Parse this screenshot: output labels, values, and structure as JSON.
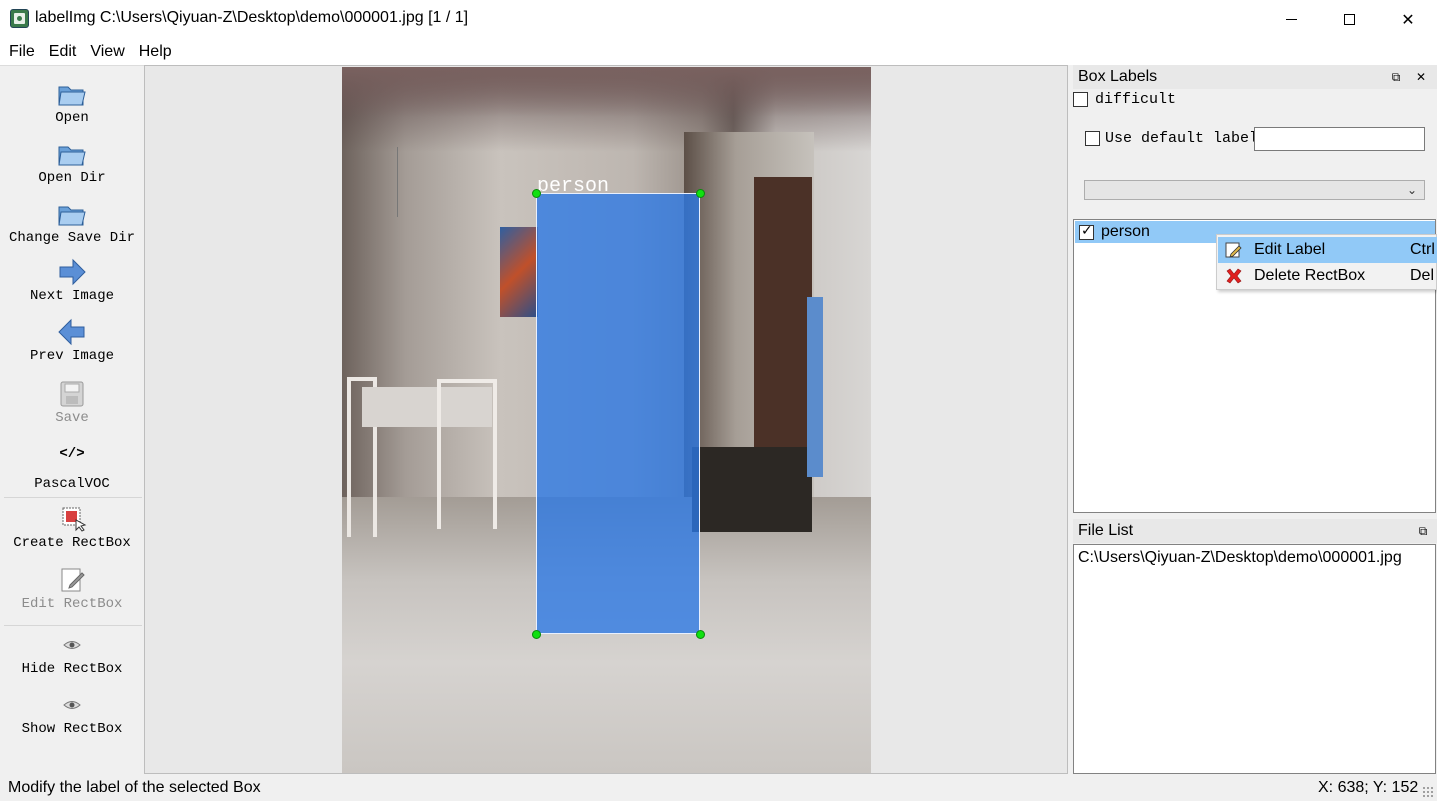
{
  "window": {
    "title": "labelImg C:\\Users\\Qiyuan-Z\\Desktop\\demo\\000001.jpg [1 / 1]"
  },
  "menu": [
    "File",
    "Edit",
    "View",
    "Help"
  ],
  "toolbar": {
    "open": "Open",
    "open_dir": "Open Dir",
    "change_save_dir": "Change Save Dir",
    "next_image": "Next Image",
    "prev_image": "Prev Image",
    "save": "Save",
    "format_icon": "</>",
    "format": "PascalVOC",
    "create_rectbox": "Create RectBox",
    "edit_rectbox": "Edit RectBox",
    "hide_rectbox": "Hide RectBox",
    "show_rectbox": "Show RectBox"
  },
  "canvas": {
    "box_label": "person"
  },
  "box_labels_panel": {
    "title": "Box Labels",
    "difficult_label": "difficult",
    "difficult_checked": false,
    "use_default_label": "Use default label",
    "use_default_checked": false,
    "default_label_value": "",
    "combo_value": "",
    "items": [
      {
        "label": "person",
        "checked": true,
        "selected": true
      }
    ]
  },
  "context_menu": {
    "items": [
      {
        "label": "Edit Label",
        "shortcut": "Ctrl",
        "icon": "edit-label-icon",
        "highlighted": true
      },
      {
        "label": "Delete RectBox",
        "shortcut": "Del",
        "icon": "delete-icon",
        "highlighted": false
      }
    ]
  },
  "file_list_panel": {
    "title": "File List",
    "files": [
      "C:\\Users\\Qiyuan-Z\\Desktop\\demo\\000001.jpg"
    ]
  },
  "statusbar": {
    "message": "Modify the label of the selected Box",
    "position": "X: 638; Y: 152"
  },
  "colors": {
    "box_fill": "#2b78e6",
    "handle": "#10e010",
    "selection": "#91c9f7"
  }
}
